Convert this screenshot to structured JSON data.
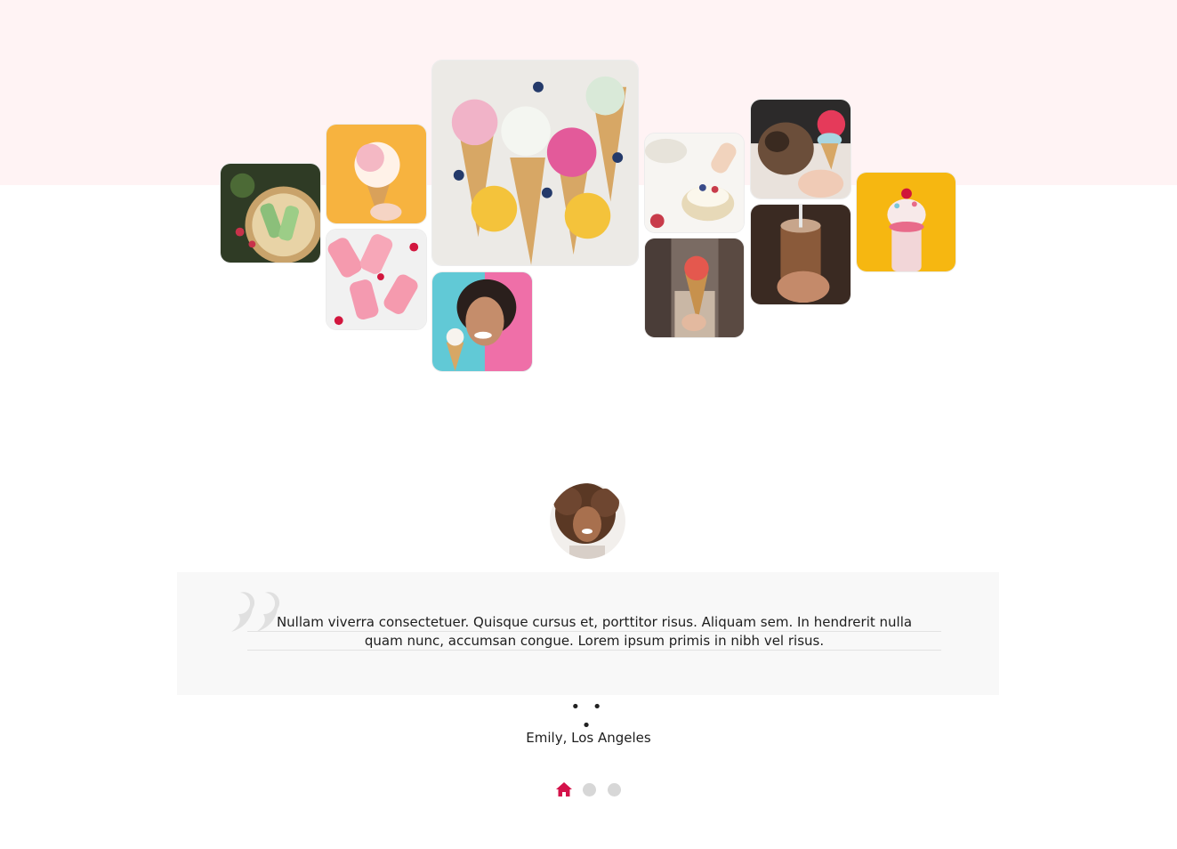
{
  "gallery": {
    "tiles": [
      {
        "name": "matcha-popsicles-photo",
        "colors": [
          "#3c4a2b",
          "#8bbf7a",
          "#c9a36b"
        ]
      },
      {
        "name": "pink-icecream-cone-photo",
        "colors": [
          "#f7b33f",
          "#f4b8c4",
          "#fff2e8"
        ]
      },
      {
        "name": "raspberry-popsicles-photo",
        "colors": [
          "#f1f1f1",
          "#f59aae",
          "#d2163e"
        ]
      },
      {
        "name": "icecream-cones-flatlay-photo",
        "colors": [
          "#eceae6",
          "#e35a9a",
          "#f4c33b"
        ]
      },
      {
        "name": "smiling-woman-icecream-photo",
        "colors": [
          "#61c9d6",
          "#ef6fa8",
          "#2a1f1c"
        ]
      },
      {
        "name": "berry-dessert-bowls-photo",
        "colors": [
          "#f7f5f2",
          "#e7d9b8",
          "#c83b4a"
        ]
      },
      {
        "name": "street-icecream-cone-photo",
        "colors": [
          "#7a6b63",
          "#e4584e",
          "#c9b7a5"
        ]
      },
      {
        "name": "dog-licking-icecream-photo",
        "colors": [
          "#e9e2dc",
          "#6b4e3a",
          "#e53a5a"
        ]
      },
      {
        "name": "chocolate-milkshake-photo",
        "colors": [
          "#3a2a22",
          "#8a5a3a",
          "#c7a58b"
        ]
      },
      {
        "name": "freakshake-jar-photo",
        "colors": [
          "#f6b711",
          "#f2d6d8",
          "#e86b8a"
        ]
      }
    ]
  },
  "testimonial": {
    "avatar_name": "woman-curly-hair-avatar",
    "quote_line1": "Nullam viverra consectetuer. Quisque cursus et, porttitor risus. Aliquam sem. In hendrerit nulla",
    "quote_line2": "quam nunc, accumsan congue. Lorem ipsum primis in nibh vel risus.",
    "separator": "• • •",
    "author": "Emily, Los Angeles"
  },
  "pager": {
    "icons": [
      "home-icon"
    ],
    "accent": "#d4124a",
    "inactive": "#d7d7d7"
  },
  "colors": {
    "band": "#fff3f4",
    "quote_bg": "#f8f8f8",
    "quote_mark": "#e0e0e0"
  }
}
